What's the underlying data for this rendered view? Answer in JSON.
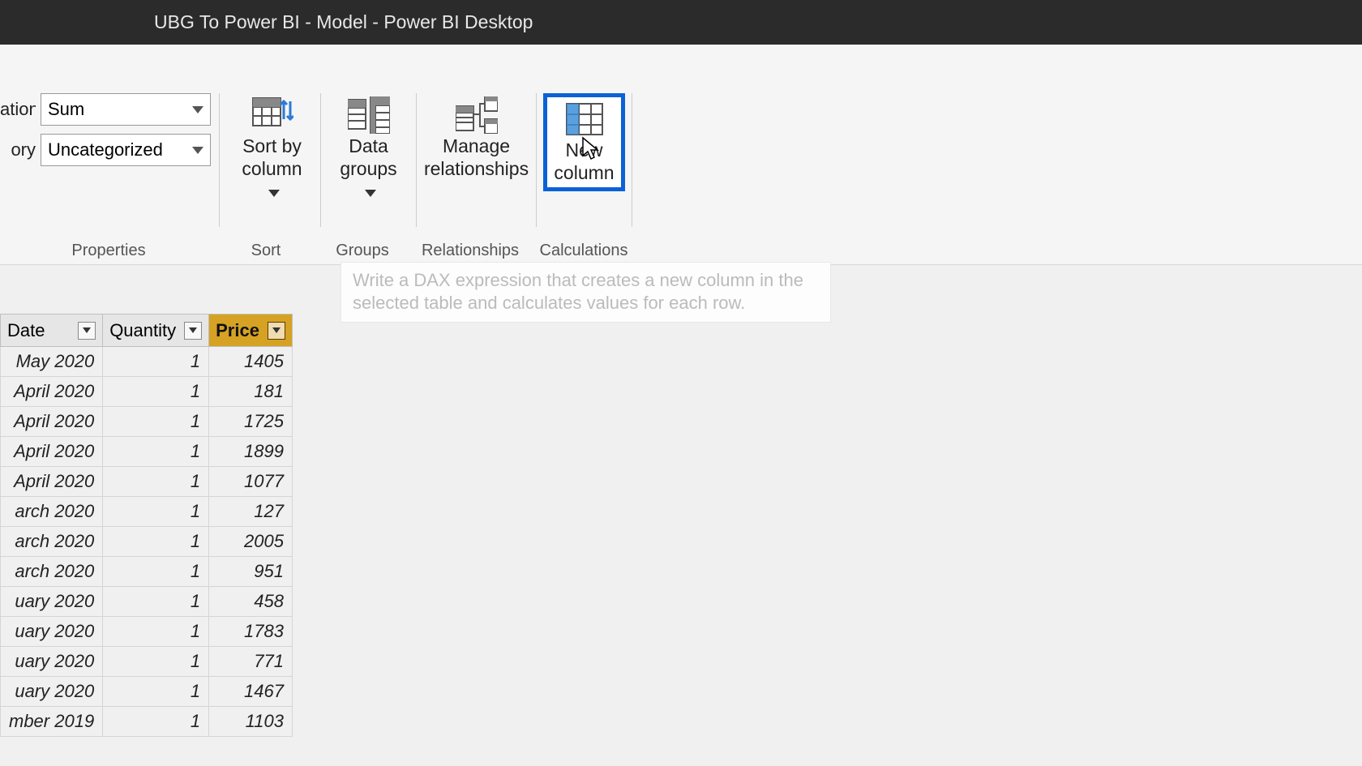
{
  "window": {
    "title": "UBG To Power BI - Model - Power BI Desktop"
  },
  "properties": {
    "aggregation_label_fragment": "ation",
    "aggregation_value": "Sum",
    "category_label_fragment": "ory",
    "category_value": "Uncategorized",
    "group_label": "Properties"
  },
  "ribbon": {
    "sort": {
      "label": "Sort by\ncolumn",
      "group": "Sort"
    },
    "groups": {
      "label": "Data\ngroups",
      "group": "Groups"
    },
    "relationships": {
      "label": "Manage\nrelationships",
      "group": "Relationships"
    },
    "newcolumn": {
      "label_line1": "New",
      "label_line2": "column",
      "group": "Calculations"
    }
  },
  "tooltip": {
    "text": "Write a DAX expression that creates a new column in the selected table and calculates values for each row."
  },
  "table": {
    "columns": {
      "date": "Date",
      "quantity": "Quantity",
      "price": "Price"
    },
    "rows": [
      {
        "date": "May 2020",
        "quantity": 1,
        "price": 1405
      },
      {
        "date": "April 2020",
        "quantity": 1,
        "price": 181
      },
      {
        "date": "April 2020",
        "quantity": 1,
        "price": 1725
      },
      {
        "date": "April 2020",
        "quantity": 1,
        "price": 1899
      },
      {
        "date": "April 2020",
        "quantity": 1,
        "price": 1077
      },
      {
        "date": "arch 2020",
        "quantity": 1,
        "price": 127
      },
      {
        "date": "arch 2020",
        "quantity": 1,
        "price": 2005
      },
      {
        "date": "arch 2020",
        "quantity": 1,
        "price": 951
      },
      {
        "date": "uary 2020",
        "quantity": 1,
        "price": 458
      },
      {
        "date": "uary 2020",
        "quantity": 1,
        "price": 1783
      },
      {
        "date": "uary 2020",
        "quantity": 1,
        "price": 771
      },
      {
        "date": "uary 2020",
        "quantity": 1,
        "price": 1467
      },
      {
        "date": "mber 2019",
        "quantity": 1,
        "price": 1103
      }
    ]
  }
}
